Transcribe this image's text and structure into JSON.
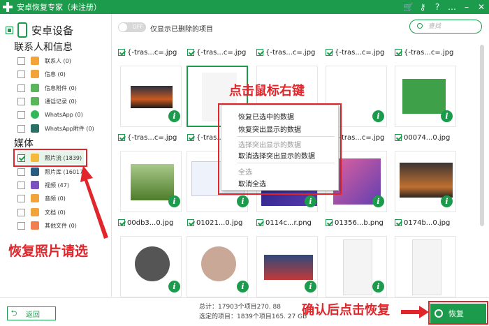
{
  "app": {
    "title": "安卓恢复专家（未注册）"
  },
  "titlebar_icons": [
    "cart-icon",
    "key-icon",
    "help-icon",
    "chat-icon",
    "minimize-icon",
    "close-icon"
  ],
  "sidebar": {
    "device": "安卓设备",
    "group1": "联系人和信息",
    "group2": "媒体",
    "items": [
      {
        "label": "联系人 (0)",
        "color": "#f2a33a"
      },
      {
        "label": "信息 (0)",
        "color": "#f2a33a"
      },
      {
        "label": "信息附件 (0)",
        "color": "#5bb55b"
      },
      {
        "label": "通话记录 (0)",
        "color": "#5bb55b"
      },
      {
        "label": "WhatsApp (0)",
        "color": "#2fb75a"
      },
      {
        "label": "WhatsApp附件 (0)",
        "color": "#2a6f66"
      }
    ],
    "media": [
      {
        "label": "照片流 (1839)",
        "color": "#f5b93c"
      },
      {
        "label": "照片库 (16017)",
        "color": "#2a5d80"
      },
      {
        "label": "视频 (47)",
        "color": "#7a4fc0"
      },
      {
        "label": "音频 (0)",
        "color": "#f2a33a"
      },
      {
        "label": "文档 (0)",
        "color": "#f2a33a"
      },
      {
        "label": "其他文件 (0)",
        "color": "#f08050"
      }
    ]
  },
  "toolbar": {
    "toggle": "OFF",
    "toggle_label": "仅显示已删除的项目",
    "search_placeholder": "查找"
  },
  "files": {
    "row1": [
      "{-tras...c=.jpg",
      "{-tras...c=.jpg",
      "{-tras...c=.jpg",
      "{-tras...c=.jpg",
      "{-tras...c=.jpg"
    ],
    "row2": [
      "{-tras...c=.jpg",
      "{-tras...c=.jpg",
      "{-tras...c=.jpg",
      "{-tras...c=.jpg",
      "00074...0.jpg"
    ],
    "row3": [
      "00db3...0.jpg",
      "01021...0.jpg",
      "0114c...r.png",
      "01356...b.png",
      "0174b...0.jpg"
    ]
  },
  "context_menu": {
    "items": [
      "恢复已选中的数据",
      "恢复突出显示的数据",
      "选择突出显示的数据",
      "取消选择突出显示的数据",
      "全选",
      "取消全选"
    ]
  },
  "annotations": {
    "right_click": "点击鼠标右键",
    "recover_photos": "恢复照片请选",
    "confirm": "确认后点击恢复"
  },
  "bottom": {
    "back": "返回",
    "total": "总计：17903个项目270. 88",
    "selected": "选定的项目：1839个项目165. 27 GB",
    "recover": "恢复"
  }
}
